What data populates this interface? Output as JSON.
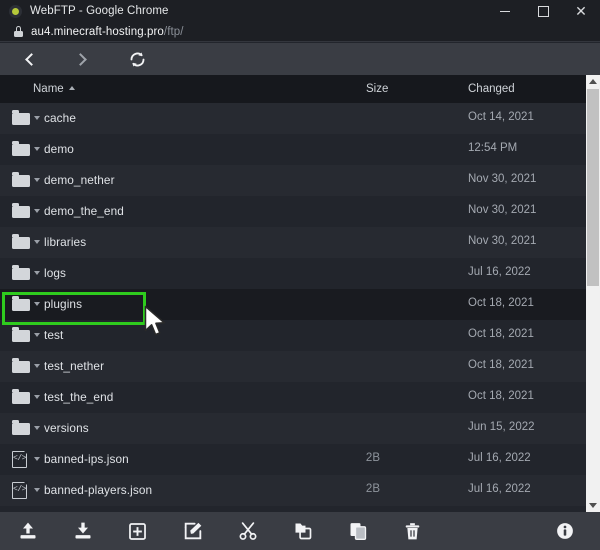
{
  "window": {
    "title": "WebFTP - Google Chrome",
    "favicon": "webftp-favicon",
    "minimize_label": "",
    "maximize_label": "",
    "close_label": "✕"
  },
  "address": {
    "lock_icon": "lock-icon",
    "host": "au4.minecraft-hosting.pro",
    "path": "/ftp/"
  },
  "nav": {
    "back_icon": "chevron-left-icon",
    "forward_icon": "chevron-right-icon",
    "refresh_icon": "refresh-icon"
  },
  "columns": {
    "name": "Name",
    "sort_indicator": "ascending",
    "size": "Size",
    "changed": "Changed"
  },
  "files": [
    {
      "name": "cache",
      "type": "folder",
      "size": "",
      "changed": "Oct 14, 2021"
    },
    {
      "name": "demo",
      "type": "folder",
      "size": "",
      "changed": "12:54 PM"
    },
    {
      "name": "demo_nether",
      "type": "folder",
      "size": "",
      "changed": "Nov 30, 2021"
    },
    {
      "name": "demo_the_end",
      "type": "folder",
      "size": "",
      "changed": "Nov 30, 2021"
    },
    {
      "name": "libraries",
      "type": "folder",
      "size": "",
      "changed": "Nov 30, 2021"
    },
    {
      "name": "logs",
      "type": "folder",
      "size": "",
      "changed": "Jul 16, 2022"
    },
    {
      "name": "plugins",
      "type": "folder",
      "size": "",
      "changed": "Oct 18, 2021"
    },
    {
      "name": "test",
      "type": "folder",
      "size": "",
      "changed": "Oct 18, 2021"
    },
    {
      "name": "test_nether",
      "type": "folder",
      "size": "",
      "changed": "Oct 18, 2021"
    },
    {
      "name": "test_the_end",
      "type": "folder",
      "size": "",
      "changed": "Oct 18, 2021"
    },
    {
      "name": "versions",
      "type": "folder",
      "size": "",
      "changed": "Jun 15, 2022"
    },
    {
      "name": "banned-ips.json",
      "type": "json",
      "size": "2B",
      "changed": "Jul 16, 2022"
    },
    {
      "name": "banned-players.json",
      "type": "json",
      "size": "2B",
      "changed": "Jul 16, 2022"
    }
  ],
  "selection": {
    "selected_index": 6,
    "highlight_color": "#2fcc1e",
    "highlighted_item": "plugins"
  },
  "toolbar": {
    "items": [
      {
        "icon": "upload-icon",
        "label": "Upload"
      },
      {
        "icon": "download-icon",
        "label": "Download"
      },
      {
        "icon": "new-folder-icon",
        "label": "New"
      },
      {
        "icon": "edit-icon",
        "label": "Edit"
      },
      {
        "icon": "cut-icon",
        "label": "Cut"
      },
      {
        "icon": "copy-icon",
        "label": "Copy"
      },
      {
        "icon": "paste-icon",
        "label": "Paste"
      },
      {
        "icon": "delete-icon",
        "label": "Delete"
      }
    ],
    "info": {
      "icon": "info-icon",
      "label": "Info"
    }
  },
  "scrollbar": {
    "up_icon": "scroll-up-icon",
    "down_icon": "scroll-down-icon"
  }
}
